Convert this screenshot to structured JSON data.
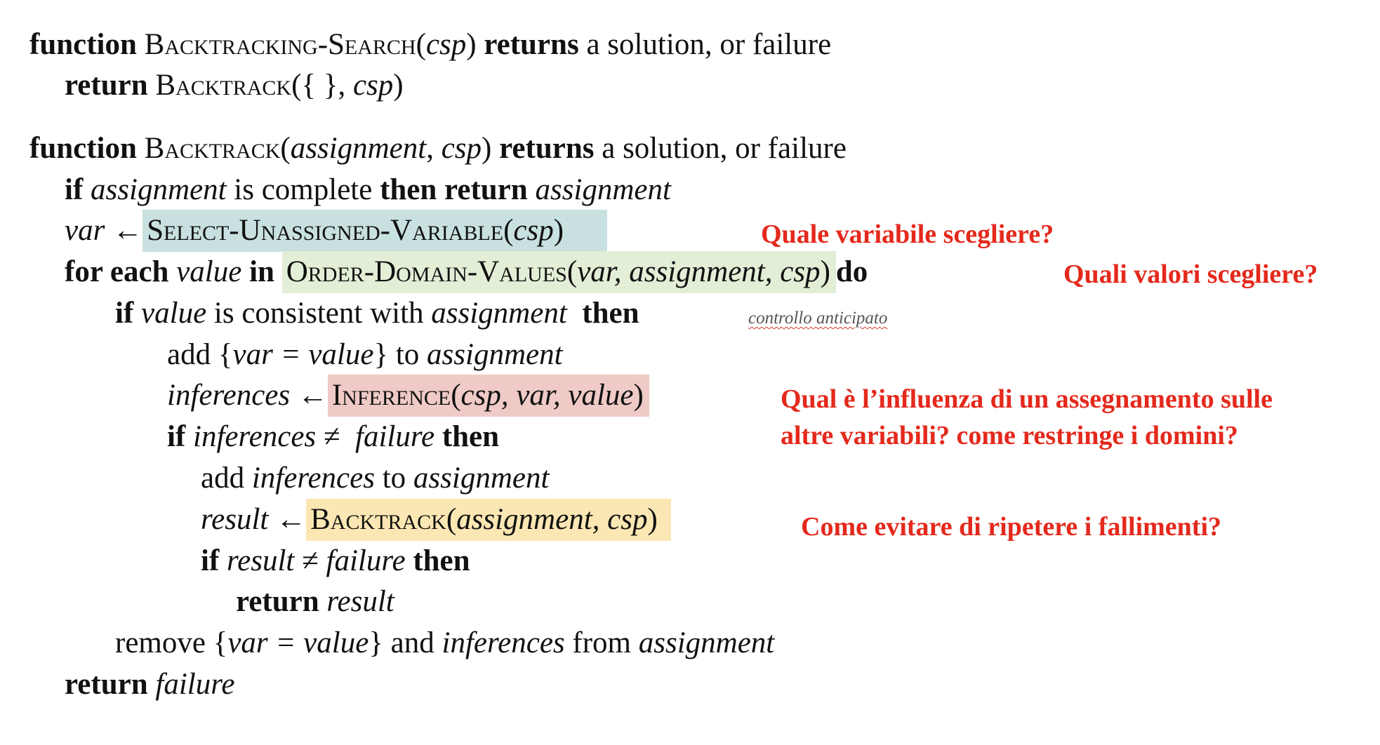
{
  "block1": {
    "line1": {
      "kw_function": "function",
      "name": "Backtracking-Search",
      "open": "(",
      "arg": "csp",
      "close": ")",
      "kw_returns": "returns",
      "tail": "a solution, or failure"
    },
    "line2": {
      "kw_return": "return",
      "name": "Backtrack",
      "args": "({ },",
      "arg": "csp",
      "close": ")"
    }
  },
  "block2": {
    "header": {
      "kw_function": "function",
      "name": "Backtrack",
      "open": "(",
      "arg1": "assignment",
      "sep": ",",
      "arg2": "csp",
      "close": ")",
      "kw_returns": "returns",
      "tail": "a solution, or failure"
    },
    "l1": {
      "kw_if": "if",
      "v": "assignment",
      "t": "is complete",
      "kw_then": "then return",
      "v2": "assignment"
    },
    "l2": {
      "v": "var",
      "arrow": "←",
      "fn": "Select-Unassigned-Variable",
      "open": "(",
      "arg": "csp",
      "close": ")"
    },
    "l3": {
      "kw_for": "for each",
      "v": "value",
      "kw_in": "in",
      "fn": "Order-Domain-Values",
      "open": "(",
      "args": "var, assignment, csp",
      "close": ")",
      "kw_do": "do"
    },
    "l4": {
      "kw_if": "if",
      "v": "value",
      "t": "is consistent with",
      "v2": "assignment",
      "kw_then": "then"
    },
    "l5": {
      "t1": "add {",
      "v": "var = value",
      "t2": "} to",
      "v2": "assignment"
    },
    "l6": {
      "v": "inferences",
      "arrow": "←",
      "fn": "Inference",
      "open": "(",
      "args": "csp, var, value",
      "close": ")"
    },
    "l7": {
      "kw_if": "if",
      "v": "inferences",
      "neq": "≠",
      "v2": "failure",
      "kw_then": "then"
    },
    "l8": {
      "t1": "add",
      "v": "inferences",
      "t2": "to",
      "v2": "assignment"
    },
    "l9": {
      "v": "result",
      "arrow": "←",
      "fn": "Backtrack",
      "open": "(",
      "args": "assignment, csp",
      "close": ")"
    },
    "l10": {
      "kw_if": "if",
      "v": "result",
      "neq": "≠",
      "v2": "failure",
      "kw_then": "then"
    },
    "l11": {
      "kw_return": "return",
      "v": "result"
    },
    "l12": {
      "t1": "remove {",
      "v": "var = value",
      "t2": "} and",
      "v2": "inferences",
      "t3": "from",
      "v3": "assignment"
    },
    "l13": {
      "kw_return": "return",
      "v": "failure"
    }
  },
  "annotations": {
    "variable_question": "Quale variabile scegliere?",
    "values_question": "Quali valori scegliere?",
    "forward_check": "controllo anticipato",
    "inference_question_line1": "Qual è l’influenza di un assegnamento sulle",
    "inference_question_line2": "altre variabili? come restringe i domini?",
    "failure_question": "Come evitare di ripetere i fallimenti?"
  },
  "colors": {
    "annotation_red": "#e4291c",
    "highlight_select_variable": "#c9e0e0",
    "highlight_order_values": "#e2eed6",
    "highlight_inference": "#efcac6",
    "highlight_backtrack": "#fbe7b3"
  }
}
